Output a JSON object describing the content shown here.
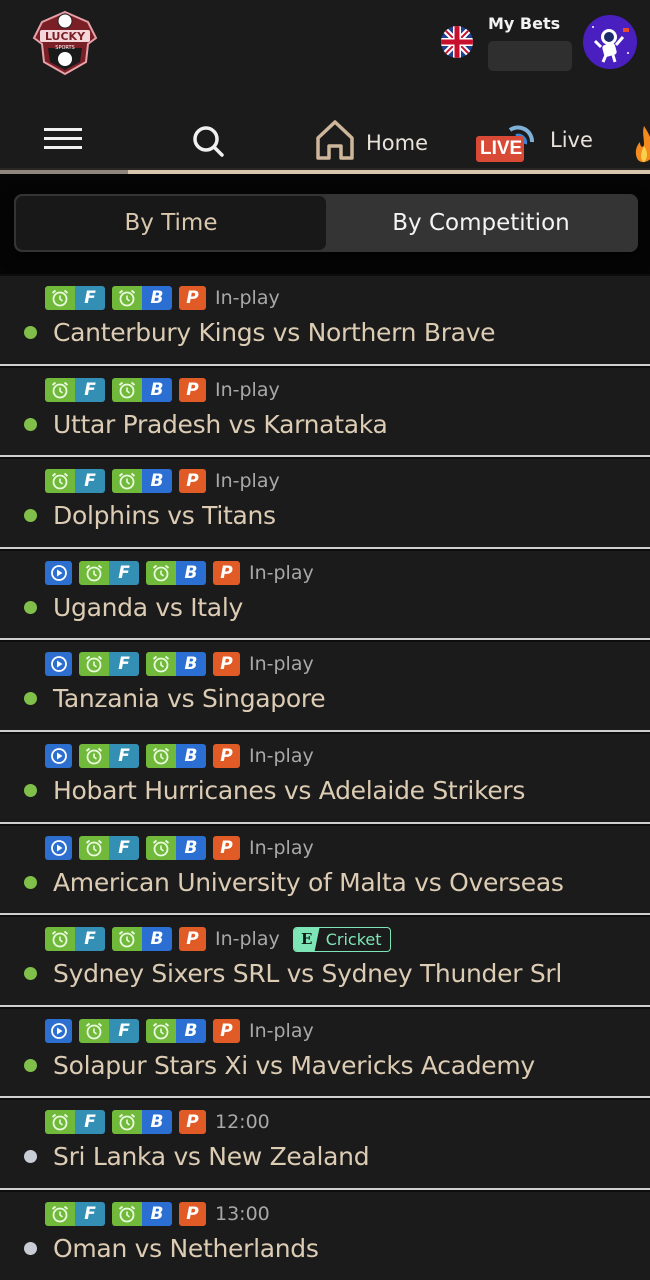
{
  "header": {
    "logo_alt": "Lucky Sports",
    "language_icon": "uk-flag-icon",
    "my_bets_label": "My Bets",
    "avatar_icon": "astronaut-avatar-icon"
  },
  "nav": {
    "menu_icon": "hamburger-icon",
    "search_icon": "search-icon",
    "items": [
      {
        "label": "Home",
        "icon": "home-icon"
      },
      {
        "label": "Live",
        "icon": "live-broadcast-icon",
        "badge": "LIVE"
      }
    ],
    "extra_icon": "fire-icon",
    "colors": {
      "underline": "#d8c6ae",
      "active": "#8f877e"
    }
  },
  "segmented": {
    "options": [
      "By Time",
      "By Competition"
    ],
    "selected": "By Time"
  },
  "badge_letters": {
    "fancy": "F",
    "bookmaker": "B",
    "premium": "P",
    "exchange": "E"
  },
  "colors": {
    "green": "#70b93a",
    "fancy_blue": "#3390b4",
    "bookmaker_blue": "#2b6fd3",
    "premium_orange": "#e05b25",
    "live_dot": "#7fbf4a",
    "upcoming_dot": "#c8ccd4",
    "match_text": "#ddccb4",
    "cricket_badge": "#7ee6b6"
  },
  "matches": [
    {
      "name": "Canterbury Kings vs Northern Brave",
      "status": "In-play",
      "live": true,
      "stream": false,
      "ecricket": false
    },
    {
      "name": "Uttar Pradesh vs Karnataka",
      "status": "In-play",
      "live": true,
      "stream": false,
      "ecricket": false
    },
    {
      "name": "Dolphins vs Titans",
      "status": "In-play",
      "live": true,
      "stream": false,
      "ecricket": false
    },
    {
      "name": "Uganda vs Italy",
      "status": "In-play",
      "live": true,
      "stream": true,
      "ecricket": false
    },
    {
      "name": "Tanzania vs Singapore",
      "status": "In-play",
      "live": true,
      "stream": true,
      "ecricket": false
    },
    {
      "name": "Hobart Hurricanes vs Adelaide Strikers",
      "status": "In-play",
      "live": true,
      "stream": true,
      "ecricket": false
    },
    {
      "name": "American University of Malta vs Overseas",
      "status": "In-play",
      "live": true,
      "stream": true,
      "ecricket": false
    },
    {
      "name": "Sydney Sixers SRL vs Sydney Thunder Srl",
      "status": "In-play",
      "live": true,
      "stream": false,
      "ecricket": true,
      "ecricket_label": "Cricket"
    },
    {
      "name": "Solapur Stars Xi vs Mavericks Academy",
      "status": "In-play",
      "live": true,
      "stream": true,
      "ecricket": false
    },
    {
      "name": "Sri Lanka vs New Zealand",
      "status": "12:00",
      "live": false,
      "stream": false,
      "ecricket": false
    },
    {
      "name": "Oman vs Netherlands",
      "status": "13:00",
      "live": false,
      "stream": false,
      "ecricket": false
    }
  ]
}
